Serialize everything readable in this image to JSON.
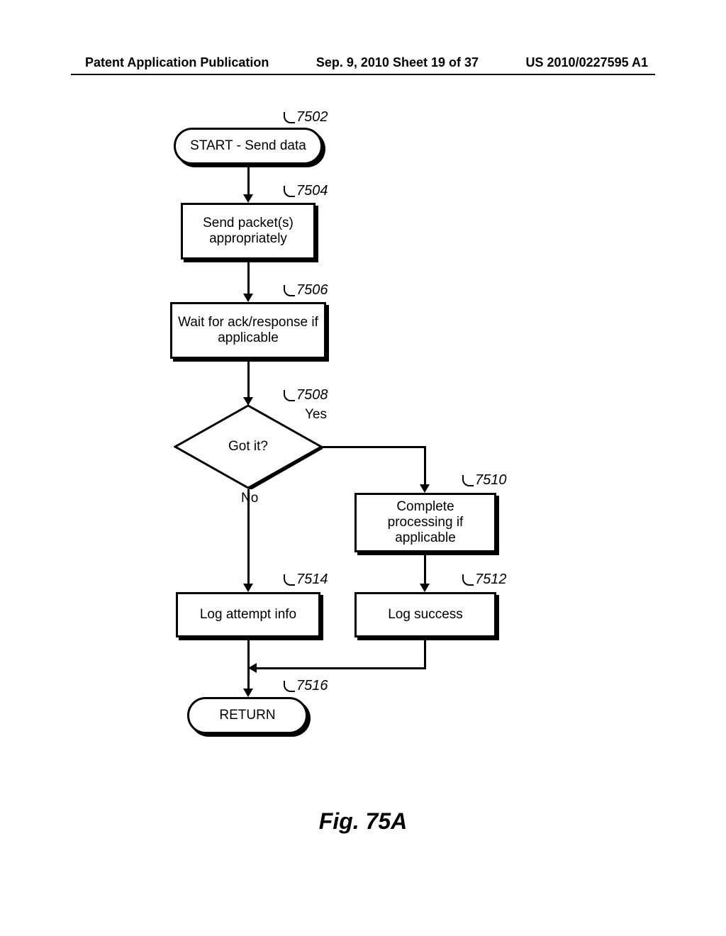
{
  "header": {
    "left": "Patent Application Publication",
    "center": "Sep. 9, 2010  Sheet 19 of 37",
    "right": "US 2010/0227595 A1"
  },
  "flowchart": {
    "nodes": {
      "start": {
        "ref": "7502",
        "text": "START - Send data"
      },
      "send": {
        "ref": "7504",
        "text": "Send packet(s) appropriately"
      },
      "wait": {
        "ref": "7506",
        "text": "Wait for ack/response if applicable"
      },
      "gotit": {
        "ref": "7508",
        "text": "Got it?",
        "yes": "Yes",
        "no": "No"
      },
      "complete": {
        "ref": "7510",
        "text": "Complete processing if applicable"
      },
      "logsuccess": {
        "ref": "7512",
        "text": "Log success"
      },
      "logattempt": {
        "ref": "7514",
        "text": "Log attempt info"
      },
      "return": {
        "ref": "7516",
        "text": "RETURN"
      }
    }
  },
  "figure": {
    "caption": "Fig. 75A"
  }
}
